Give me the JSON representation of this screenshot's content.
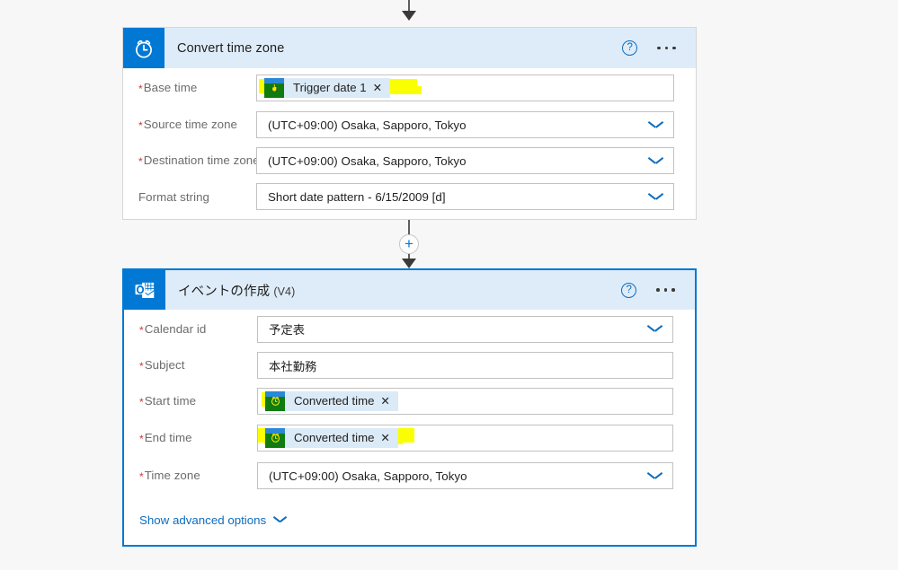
{
  "theme": {
    "canvas_bg": "#f7f7f7",
    "header_bg": "#deecf9",
    "accent_blue": "#0078d4",
    "link_blue": "#0f6cbd",
    "required_red": "#d13438",
    "highlight_yellow": "#faff00",
    "token_bg": "#dbeaf7",
    "token_icon_green": "#107c10"
  },
  "connectors": {
    "top_arrow": "arrow-down-icon",
    "insert_button_label": "+",
    "middle_arrow": "arrow-down-icon"
  },
  "cards": [
    {
      "id": "convert-time-zone",
      "title": "Convert time zone",
      "title_version": "",
      "icon": "alarm-clock-icon",
      "selected": false,
      "help_icon": "help-icon",
      "overflow_icon": "ellipsis-icon",
      "rows": [
        {
          "label": "Base time",
          "required": true,
          "type": "token",
          "token": {
            "text": "Trigger date 1",
            "icon": "power-apps-trigger-icon",
            "remove_label": "✕"
          },
          "highlighted": true
        },
        {
          "label": "Source time zone",
          "required": true,
          "type": "select",
          "value": "(UTC+09:00) Osaka, Sapporo, Tokyo",
          "chevron": "chevron-down-icon"
        },
        {
          "label": "Destination time zone",
          "required": true,
          "type": "select",
          "value": "(UTC+09:00) Osaka, Sapporo, Tokyo",
          "chevron": "chevron-down-icon"
        },
        {
          "label": "Format string",
          "required": false,
          "type": "select",
          "value": "Short date pattern - 6/15/2009 [d]",
          "chevron": "chevron-down-icon"
        }
      ]
    },
    {
      "id": "create-event-v4",
      "title": "イベントの作成",
      "title_version": "(V4)",
      "icon": "outlook-icon",
      "selected": true,
      "help_icon": "help-icon",
      "overflow_icon": "ellipsis-icon",
      "rows": [
        {
          "label": "Calendar id",
          "required": true,
          "type": "select",
          "value": "予定表",
          "chevron": "chevron-down-icon"
        },
        {
          "label": "Subject",
          "required": true,
          "type": "text",
          "value": "本社勤務"
        },
        {
          "label": "Start time",
          "required": true,
          "type": "token",
          "token": {
            "text": "Converted time",
            "icon": "alarm-clock-token-icon",
            "remove_label": "✕"
          },
          "highlighted": true
        },
        {
          "label": "End time",
          "required": true,
          "type": "token",
          "token": {
            "text": "Converted time",
            "icon": "alarm-clock-token-icon",
            "remove_label": "✕"
          },
          "highlighted": true
        },
        {
          "label": "Time zone",
          "required": true,
          "type": "select",
          "value": "(UTC+09:00) Osaka, Sapporo, Tokyo",
          "chevron": "chevron-down-icon"
        }
      ],
      "advanced_link": {
        "label": "Show advanced options",
        "chevron": "chevron-down-icon"
      }
    }
  ]
}
